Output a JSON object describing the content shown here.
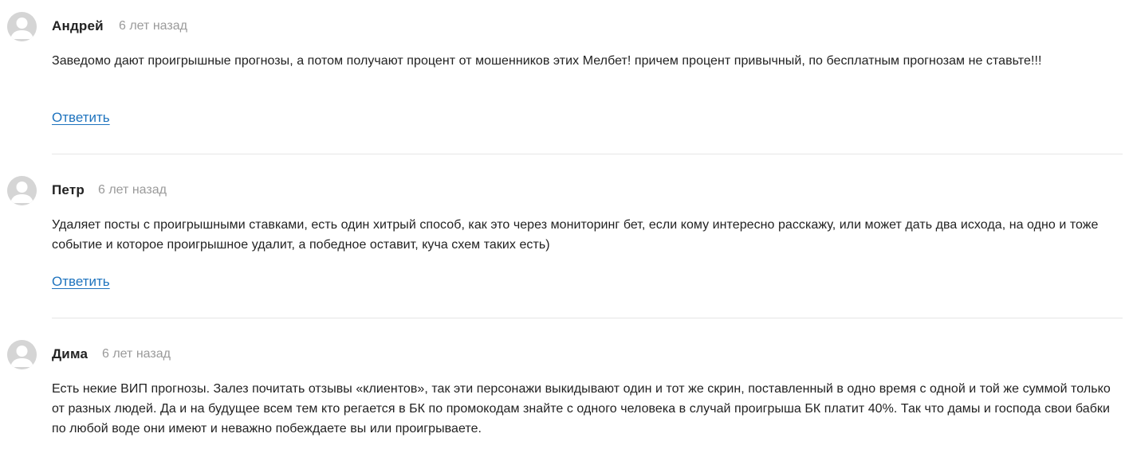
{
  "comments": [
    {
      "author": "Андрей",
      "date": "6 лет назад",
      "text": "Заведомо дают проигрышные прогнозы, а потом получают процент от мошенников этих Мелбет! причем процент привычный, по бесплатным прогнозам не ставьте!!!",
      "reply_label": "Ответить"
    },
    {
      "author": "Петр",
      "date": "6 лет назад",
      "text": "Удаляет посты с проигрышными ставками, есть один хитрый способ, как это через мониторинг бет, если кому интересно расскажу, или может дать два исхода, на одно и тоже событие и которое проигрышное удалит, а победное оставит, куча схем таких есть)",
      "reply_label": "Ответить"
    },
    {
      "author": "Дима",
      "date": "6 лет назад",
      "text": "Есть некие ВИП прогнозы. Залез почитать отзывы «клиентов», так эти персонажи выкидывают один и тот же скрин, поставленный в одно время с одной и той же суммой только от разных людей. Да и на будущее всем тем кто регается в БК по промокодам знайте с одного человека в случай проигрыша БК платит 40%. Так что дамы и господа свои бабки по любой воде они имеют и неважно побеждаете вы или проигрываете."
    }
  ],
  "colors": {
    "link": "#1e73be",
    "date": "#9a9a9a",
    "avatar_bg": "#d7d7d7",
    "divider": "#e6e6e6"
  },
  "icons": {
    "avatar": "default-user-silhouette-icon"
  }
}
